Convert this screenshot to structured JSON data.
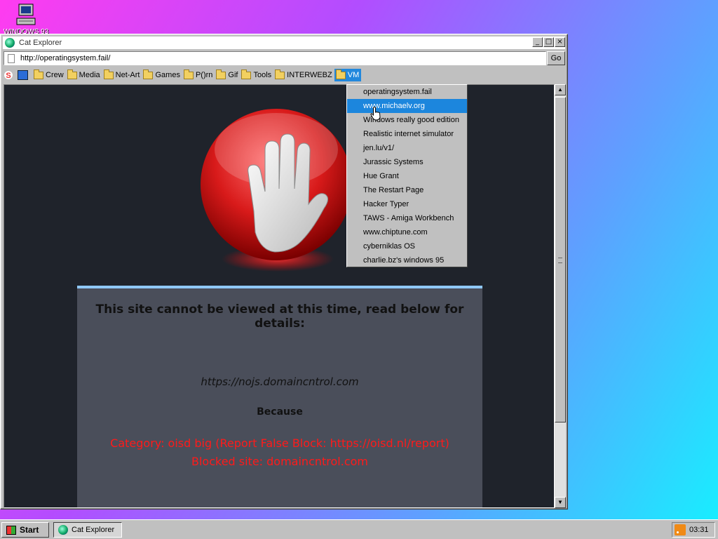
{
  "desktop": {
    "icons": [
      {
        "label": "WINDOWS 93",
        "icon": "computer-icon"
      }
    ]
  },
  "window": {
    "title": "Cat Explorer",
    "controls": {
      "minimize": "_",
      "maximize": "□",
      "close": "×"
    },
    "address": {
      "url": "http://operatingsystem.fail/",
      "go_label": "Go"
    },
    "bookmarks": [
      {
        "label": "Crew"
      },
      {
        "label": "Media"
      },
      {
        "label": "Net-Art"
      },
      {
        "label": "Games"
      },
      {
        "label": "P()rn"
      },
      {
        "label": "Gif"
      },
      {
        "label": "Tools"
      },
      {
        "label": "INTERWEBZ"
      },
      {
        "label": "VM",
        "active": true
      }
    ],
    "vm_menu": [
      "operatingsystem.fail",
      "www.michaelv.org",
      "Windows really good edition",
      "Realistic internet simulator",
      "jen.lu/v1/",
      "Jurassic Systems",
      "Hue Grant",
      "The Restart Page",
      "Hacker Typer",
      "TAWS - Amiga Workbench",
      "www.chiptune.com",
      "cyberniklas OS",
      "charlie.bz's windows 95"
    ],
    "vm_menu_highlighted_index": 1,
    "page": {
      "heading": "This site cannot be viewed at this time, read below for details:",
      "blocked_url": "https://nojs.domaincntrol.com",
      "because": "Because",
      "category": "Category: oisd big (Report False Block: https://oisd.nl/report)",
      "blocked_site": "Blocked site: domaincntrol.com"
    }
  },
  "taskbar": {
    "start_label": "Start",
    "tasks": [
      {
        "label": "Cat Explorer"
      }
    ],
    "clock": "03:31"
  }
}
